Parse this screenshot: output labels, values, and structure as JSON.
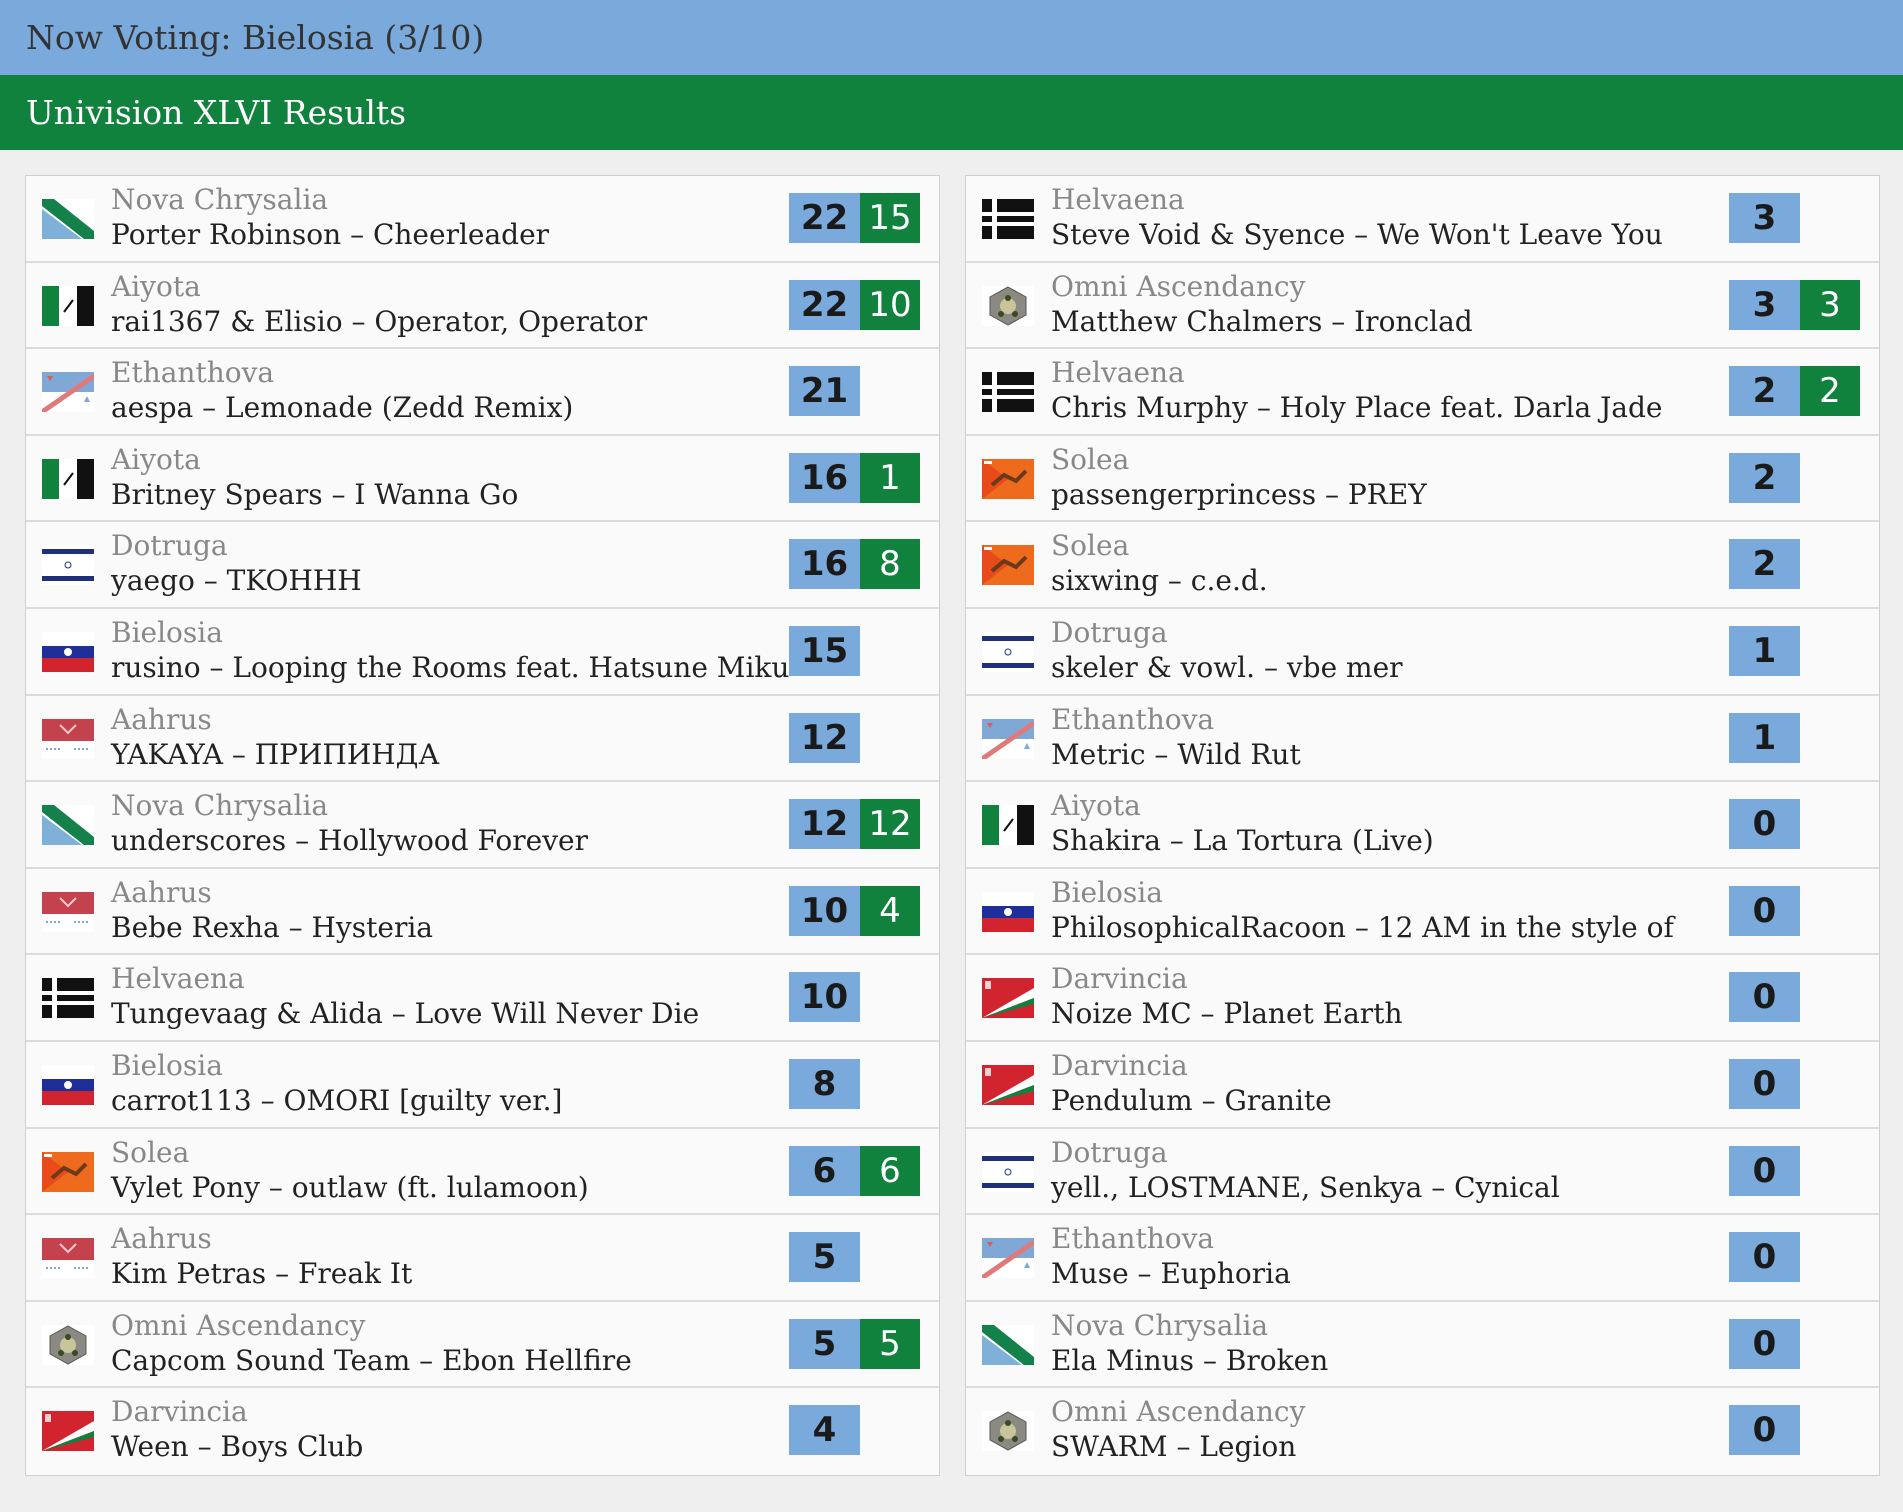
{
  "header": {
    "now_voting": "Now Voting: Bielosia (3/10)",
    "results_title": "Univision XLVI Results"
  },
  "colors": {
    "top_bar": "#79aadb",
    "results_bar": "#11813e",
    "score_bg": "#79aadb",
    "bonus_bg": "#11813e"
  },
  "left_column": [
    {
      "country": "Nova Chrysalia",
      "song": "Porter Robinson – Cheerleader",
      "score": "22",
      "bonus": "15",
      "flag": "nova-chrysalia-flag-icon"
    },
    {
      "country": "Aiyota",
      "song": "rai1367 & Elisio – Operator, Operator",
      "score": "22",
      "bonus": "10",
      "flag": "aiyota-flag-icon"
    },
    {
      "country": "Ethanthova",
      "song": "aespa – Lemonade (Zedd Remix)",
      "score": "21",
      "bonus": "",
      "flag": "ethanthova-flag-icon"
    },
    {
      "country": "Aiyota",
      "song": "Britney Spears – I Wanna Go",
      "score": "16",
      "bonus": "1",
      "flag": "aiyota-flag-icon"
    },
    {
      "country": "Dotruga",
      "song": "yaego – TKOHHH",
      "score": "16",
      "bonus": "8",
      "flag": "dotruga-flag-icon"
    },
    {
      "country": "Bielosia",
      "song": "rusino – Looping the Rooms feat. Hatsune Miku",
      "score": "15",
      "bonus": "",
      "flag": "bielosia-flag-icon"
    },
    {
      "country": "Aahrus",
      "song": "YAKAYA – ПРИПИНДА",
      "score": "12",
      "bonus": "",
      "flag": "aahrus-flag-icon"
    },
    {
      "country": "Nova Chrysalia",
      "song": "underscores – Hollywood Forever",
      "score": "12",
      "bonus": "12",
      "flag": "nova-chrysalia-flag-icon"
    },
    {
      "country": "Aahrus",
      "song": "Bebe Rexha – Hysteria",
      "score": "10",
      "bonus": "4",
      "flag": "aahrus-flag-icon"
    },
    {
      "country": "Helvaena",
      "song": "Tungevaag & Alida – Love Will Never Die",
      "score": "10",
      "bonus": "",
      "flag": "helvaena-flag-icon"
    },
    {
      "country": "Bielosia",
      "song": "carrot113 – OMORI [guilty ver.]",
      "score": "8",
      "bonus": "",
      "flag": "bielosia-flag-icon"
    },
    {
      "country": "Solea",
      "song": "Vylet Pony – outlaw (ft. lulamoon)",
      "score": "6",
      "bonus": "6",
      "flag": "solea-flag-icon"
    },
    {
      "country": "Aahrus",
      "song": "Kim Petras – Freak It",
      "score": "5",
      "bonus": "",
      "flag": "aahrus-flag-icon"
    },
    {
      "country": "Omni Ascendancy",
      "song": "Capcom Sound Team – Ebon Hellfire",
      "score": "5",
      "bonus": "5",
      "flag": "omni-ascendancy-flag-icon"
    },
    {
      "country": "Darvincia",
      "song": "Ween – Boys Club",
      "score": "4",
      "bonus": "",
      "flag": "darvincia-flag-icon"
    }
  ],
  "right_column": [
    {
      "country": "Helvaena",
      "song": "Steve Void & Syence – We Won't Leave You",
      "score": "3",
      "bonus": "",
      "flag": "helvaena-flag-icon"
    },
    {
      "country": "Omni Ascendancy",
      "song": "Matthew Chalmers – Ironclad",
      "score": "3",
      "bonus": "3",
      "flag": "omni-ascendancy-flag-icon"
    },
    {
      "country": "Helvaena",
      "song": "Chris Murphy – Holy Place feat. Darla Jade",
      "score": "2",
      "bonus": "2",
      "flag": "helvaena-flag-icon"
    },
    {
      "country": "Solea",
      "song": "passengerprincess – PREY",
      "score": "2",
      "bonus": "",
      "flag": "solea-flag-icon"
    },
    {
      "country": "Solea",
      "song": "sixwing – c.e.d.",
      "score": "2",
      "bonus": "",
      "flag": "solea-flag-icon"
    },
    {
      "country": "Dotruga",
      "song": "skeler & vowl. – vbe mer",
      "score": "1",
      "bonus": "",
      "flag": "dotruga-flag-icon"
    },
    {
      "country": "Ethanthova",
      "song": "Metric – Wild Rut",
      "score": "1",
      "bonus": "",
      "flag": "ethanthova-flag-icon"
    },
    {
      "country": "Aiyota",
      "song": "Shakira – La Tortura (Live)",
      "score": "0",
      "bonus": "",
      "flag": "aiyota-flag-icon"
    },
    {
      "country": "Bielosia",
      "song": "PhilosophicalRacoon – 12 AM in the style of",
      "score": "0",
      "bonus": "",
      "flag": "bielosia-flag-icon"
    },
    {
      "country": "Darvincia",
      "song": "Noize MC – Planet Earth",
      "score": "0",
      "bonus": "",
      "flag": "darvincia-flag-icon"
    },
    {
      "country": "Darvincia",
      "song": "Pendulum – Granite",
      "score": "0",
      "bonus": "",
      "flag": "darvincia-flag-icon"
    },
    {
      "country": "Dotruga",
      "song": "yell., LOSTMANE, Senkya – Cynical",
      "score": "0",
      "bonus": "",
      "flag": "dotruga-flag-icon"
    },
    {
      "country": "Ethanthova",
      "song": "Muse – Euphoria",
      "score": "0",
      "bonus": "",
      "flag": "ethanthova-flag-icon"
    },
    {
      "country": "Nova Chrysalia",
      "song": "Ela Minus – Broken",
      "score": "0",
      "bonus": "",
      "flag": "nova-chrysalia-flag-icon"
    },
    {
      "country": "Omni Ascendancy",
      "song": "SWARM – Legion",
      "score": "0",
      "bonus": "",
      "flag": "omni-ascendancy-flag-icon"
    }
  ]
}
